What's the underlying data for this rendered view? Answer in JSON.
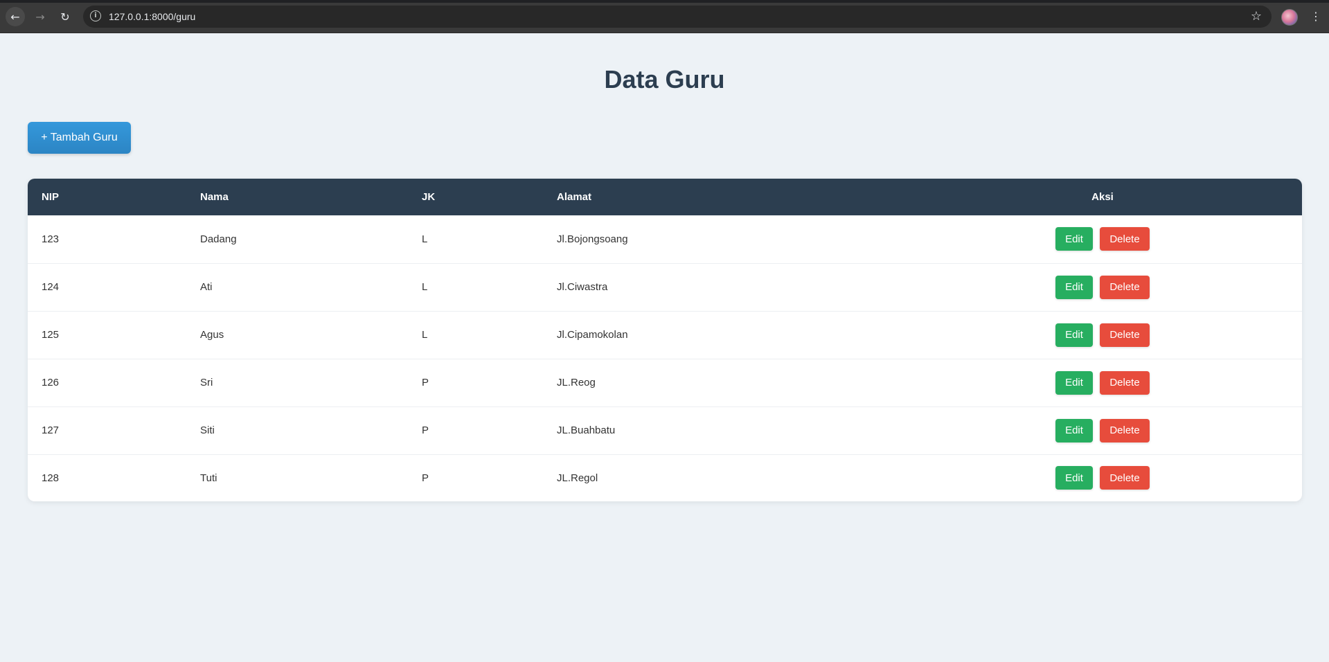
{
  "browser": {
    "url": "127.0.0.1:8000/guru",
    "icons": [
      "back-arrow-icon",
      "forward-arrow-icon",
      "reload-icon",
      "site-info-icon",
      "bookmark-star-icon",
      "profile-avatar",
      "kebab-menu-icon"
    ]
  },
  "page": {
    "title": "Data Guru",
    "add_button_label": "+ Tambah Guru"
  },
  "table": {
    "headers": {
      "nip": "NIP",
      "nama": "Nama",
      "jk": "JK",
      "alamat": "Alamat",
      "aksi": "Aksi"
    },
    "rows": [
      {
        "nip": "123",
        "nama": "Dadang",
        "jk": "L",
        "alamat": "Jl.Bojongsoang",
        "edit": "Edit",
        "delete": "Delete"
      },
      {
        "nip": "124",
        "nama": "Ati",
        "jk": "L",
        "alamat": "Jl.Ciwastra",
        "edit": "Edit",
        "delete": "Delete"
      },
      {
        "nip": "125",
        "nama": "Agus",
        "jk": "L",
        "alamat": "Jl.Cipamokolan",
        "edit": "Edit",
        "delete": "Delete"
      },
      {
        "nip": "126",
        "nama": "Sri",
        "jk": "P",
        "alamat": "JL.Reog",
        "edit": "Edit",
        "delete": "Delete"
      },
      {
        "nip": "127",
        "nama": "Siti",
        "jk": "P",
        "alamat": "JL.Buahbatu",
        "edit": "Edit",
        "delete": "Delete"
      },
      {
        "nip": "128",
        "nama": "Tuti",
        "jk": "P",
        "alamat": "JL.Regol",
        "edit": "Edit",
        "delete": "Delete"
      }
    ]
  },
  "colors": {
    "header_bg": "#2c3e50",
    "primary": "#3498db",
    "edit": "#27ae60",
    "delete": "#e74c3c",
    "page_bg": "#edf2f6"
  }
}
